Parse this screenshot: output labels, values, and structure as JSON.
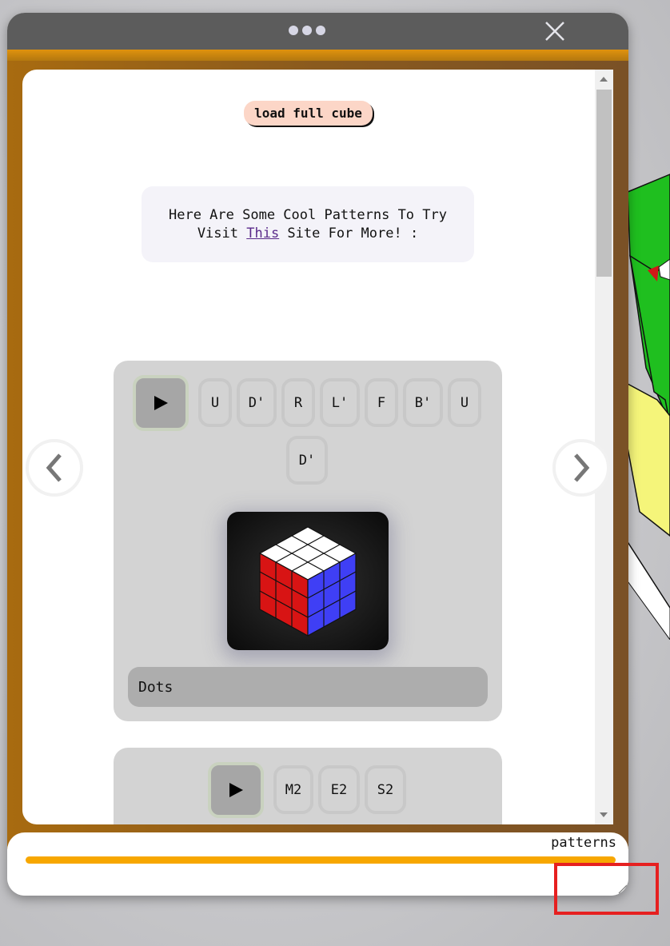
{
  "window": {
    "menu_icon": "more-dots-icon",
    "close_icon": "close-icon"
  },
  "content": {
    "load_button_label": "load full cube",
    "info_line1": "Here Are Some Cool Patterns To Try",
    "info_line2_prefix": "Visit ",
    "info_link": "This",
    "info_line2_suffix": " Site For More! :"
  },
  "patterns": [
    {
      "name": "Dots",
      "moves": [
        "U",
        "D'",
        "R",
        "L'",
        "F",
        "B'",
        "U",
        "D'"
      ]
    },
    {
      "name": "",
      "moves": [
        "M2",
        "E2",
        "S2"
      ]
    }
  ],
  "navigation": {
    "prev_icon": "chevron-left-icon",
    "next_icon": "chevron-right-icon"
  },
  "footer": {
    "label": "patterns",
    "progress": 1.0,
    "progress_color": "#f7a700"
  },
  "colors": {
    "accent_orange": "#f7a700",
    "frame_brown": "#8a5a1e",
    "highlight_red": "#e62020"
  }
}
